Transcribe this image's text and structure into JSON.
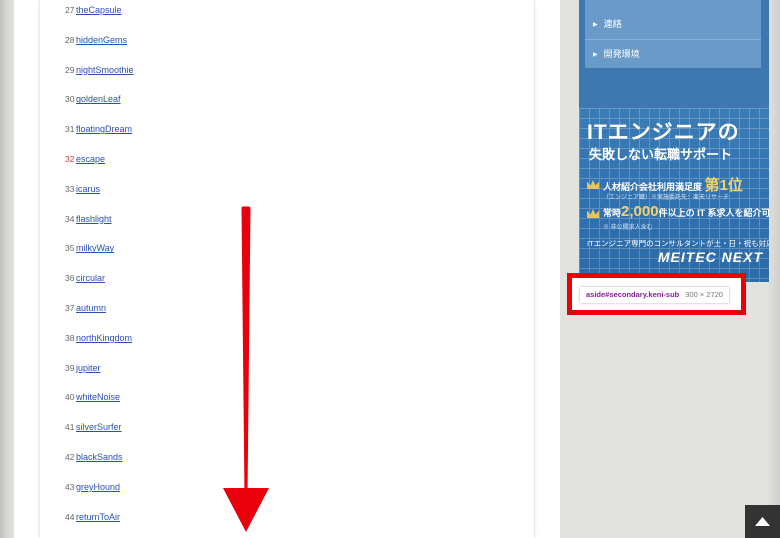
{
  "list": [
    {
      "num": "27",
      "label": "theCapsule",
      "highlight": false
    },
    {
      "num": "28",
      "label": "hiddenGems",
      "highlight": false
    },
    {
      "num": "29",
      "label": "nightSmoothie",
      "highlight": false
    },
    {
      "num": "30",
      "label": "goldenLeaf",
      "highlight": false
    },
    {
      "num": "31",
      "label": "floatingDream",
      "highlight": false
    },
    {
      "num": "32",
      "label": "escape",
      "highlight": true
    },
    {
      "num": "33",
      "label": "icarus",
      "highlight": false
    },
    {
      "num": "34",
      "label": "flashlight",
      "highlight": false
    },
    {
      "num": "35",
      "label": "milkyWay",
      "highlight": false
    },
    {
      "num": "36",
      "label": "circular",
      "highlight": false
    },
    {
      "num": "37",
      "label": "autumn",
      "highlight": false
    },
    {
      "num": "38",
      "label": "northKingdom",
      "highlight": false
    },
    {
      "num": "39",
      "label": "jupiter",
      "highlight": false
    },
    {
      "num": "40",
      "label": "whiteNoise",
      "highlight": false
    },
    {
      "num": "41",
      "label": "silverSurfer",
      "highlight": false
    },
    {
      "num": "42",
      "label": "blackSands",
      "highlight": false
    },
    {
      "num": "43",
      "label": "greyHound",
      "highlight": false
    },
    {
      "num": "44",
      "label": "returnToAir",
      "highlight": false
    }
  ],
  "sidebar": {
    "menu": [
      {
        "label": "連絡"
      },
      {
        "label": "開発環境"
      }
    ],
    "banner": {
      "title": "ITエンジニアの",
      "subtitle": "失敗しない転職サポート",
      "line1": "人材紹介会社利用満足度",
      "line1_big": "第1位",
      "line1_small": "（エンジニア職）※実施委託先：楽天リサーチ",
      "line2": "常時",
      "line2_big": "2,000",
      "line2_rest": "件以上の IT 系求人を紹介可能",
      "line2_small": "※ 非公開求人含む",
      "bottom": "ITエンジニア専門のコンサルタントが土・日・祝も対応",
      "logo": "MEITEC NEXT"
    }
  },
  "inspector": {
    "selector": "aside#secondary.keni-sub",
    "size": "300 × 2720"
  },
  "colors": {
    "link": "#2a4fb7",
    "highlight_number": "#d13b3b",
    "arrow": "#e8000b",
    "inspector_border": "#e8000b"
  },
  "icons": {
    "scroll_top": "chevron-up-icon",
    "menu_bullet": "triangle-right-icon",
    "arrow": "arrow-down-icon"
  }
}
